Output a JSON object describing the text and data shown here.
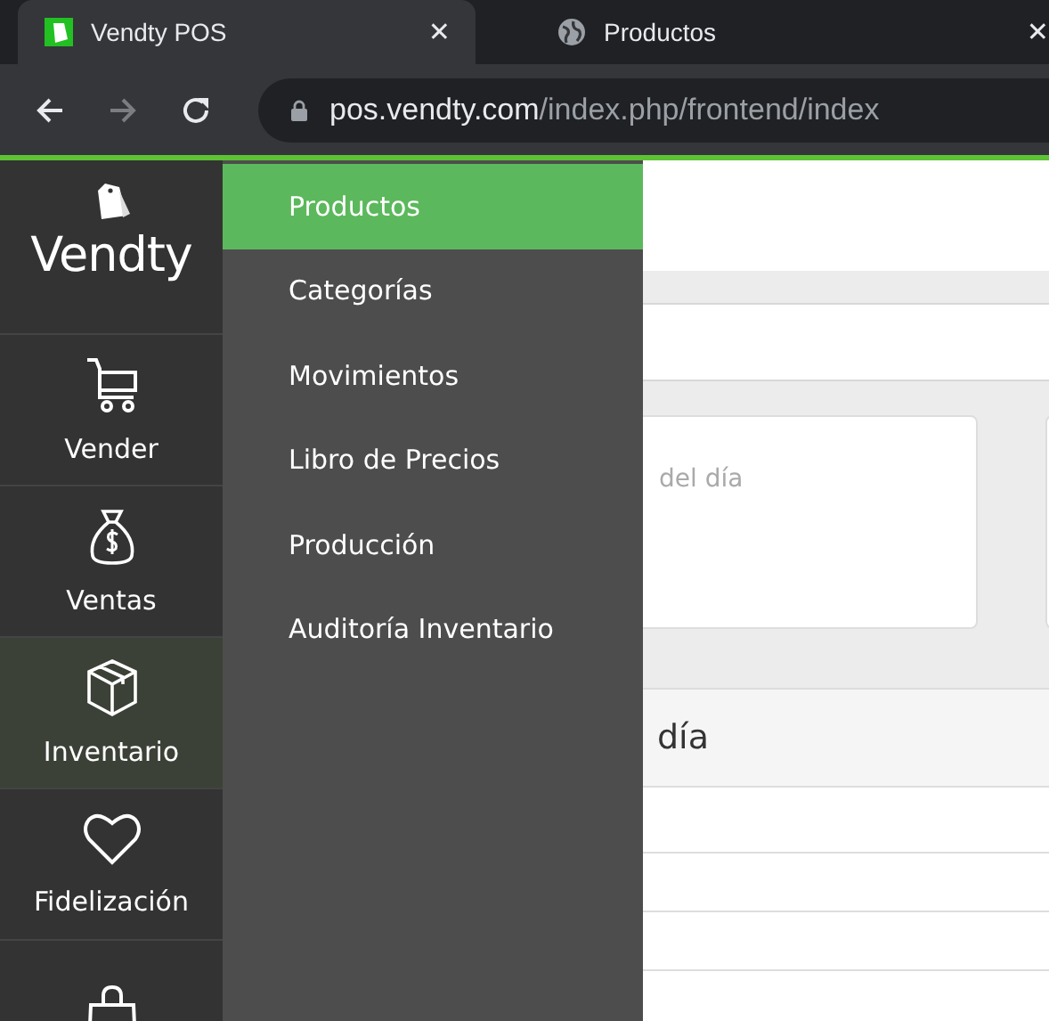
{
  "browser": {
    "tabs": [
      {
        "title": "Vendty POS",
        "selected": true,
        "close": "✕"
      },
      {
        "title": "Productos",
        "selected": false,
        "close": "✕"
      }
    ],
    "address": {
      "host": "pos.vendty.com",
      "path": "/index.php/frontend/index"
    },
    "forward_disabled": true
  },
  "sidebar": {
    "logo": "Vendty",
    "items": [
      {
        "label": "Vender",
        "selected": false
      },
      {
        "label": "Ventas",
        "selected": false
      },
      {
        "label": "Inventario",
        "selected": true
      },
      {
        "label": "Fidelización",
        "selected": false
      },
      {
        "selected": false
      }
    ]
  },
  "submenu": [
    {
      "label": "Productos",
      "selected": true
    },
    {
      "label": "Categorías",
      "selected": false
    },
    {
      "label": "Movimientos",
      "selected": false
    },
    {
      "label": "Libro de Precios",
      "selected": false
    },
    {
      "label": "Producción",
      "selected": false
    },
    {
      "label": "Auditoría Inventario",
      "selected": false
    }
  ],
  "content": {
    "card_text": "del día",
    "section_title": "día"
  }
}
